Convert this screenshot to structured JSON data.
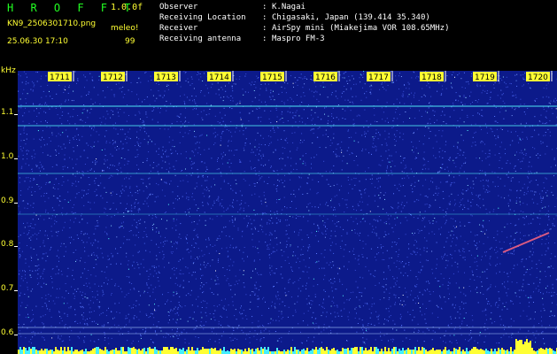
{
  "header": {
    "app_title": "H R O F F T",
    "version": "1.0.0f",
    "file_name": "KN9_2506301710.png",
    "mode": "meleo!",
    "timestamp": "25.06.30 17:10",
    "count": "99"
  },
  "info": [
    {
      "label": "Observer",
      "value": "K.Nagai"
    },
    {
      "label": "Receiving Location",
      "value": "Chigasaki, Japan (139.414 35.340)"
    },
    {
      "label": "Receiver",
      "value": "AirSpy mini (Miakejima VOR 108.65MHz)"
    },
    {
      "label": "Receiving antenna",
      "value": "Maspro FM-3"
    }
  ],
  "axis": {
    "unit": "kHz",
    "freq_ticks": [
      "1.1",
      "1.0",
      "0.9",
      "0.8",
      "0.7",
      "0.6"
    ],
    "time_ticks": [
      "1711",
      "1712",
      "1713",
      "1714",
      "1715",
      "1716",
      "1717",
      "1718",
      "1719",
      "1720"
    ]
  },
  "colors": {
    "background": "#0c1a8a",
    "label_yellow": "#ffff33",
    "title_green": "#22ff22",
    "signal_cyan": "#55ffff"
  }
}
